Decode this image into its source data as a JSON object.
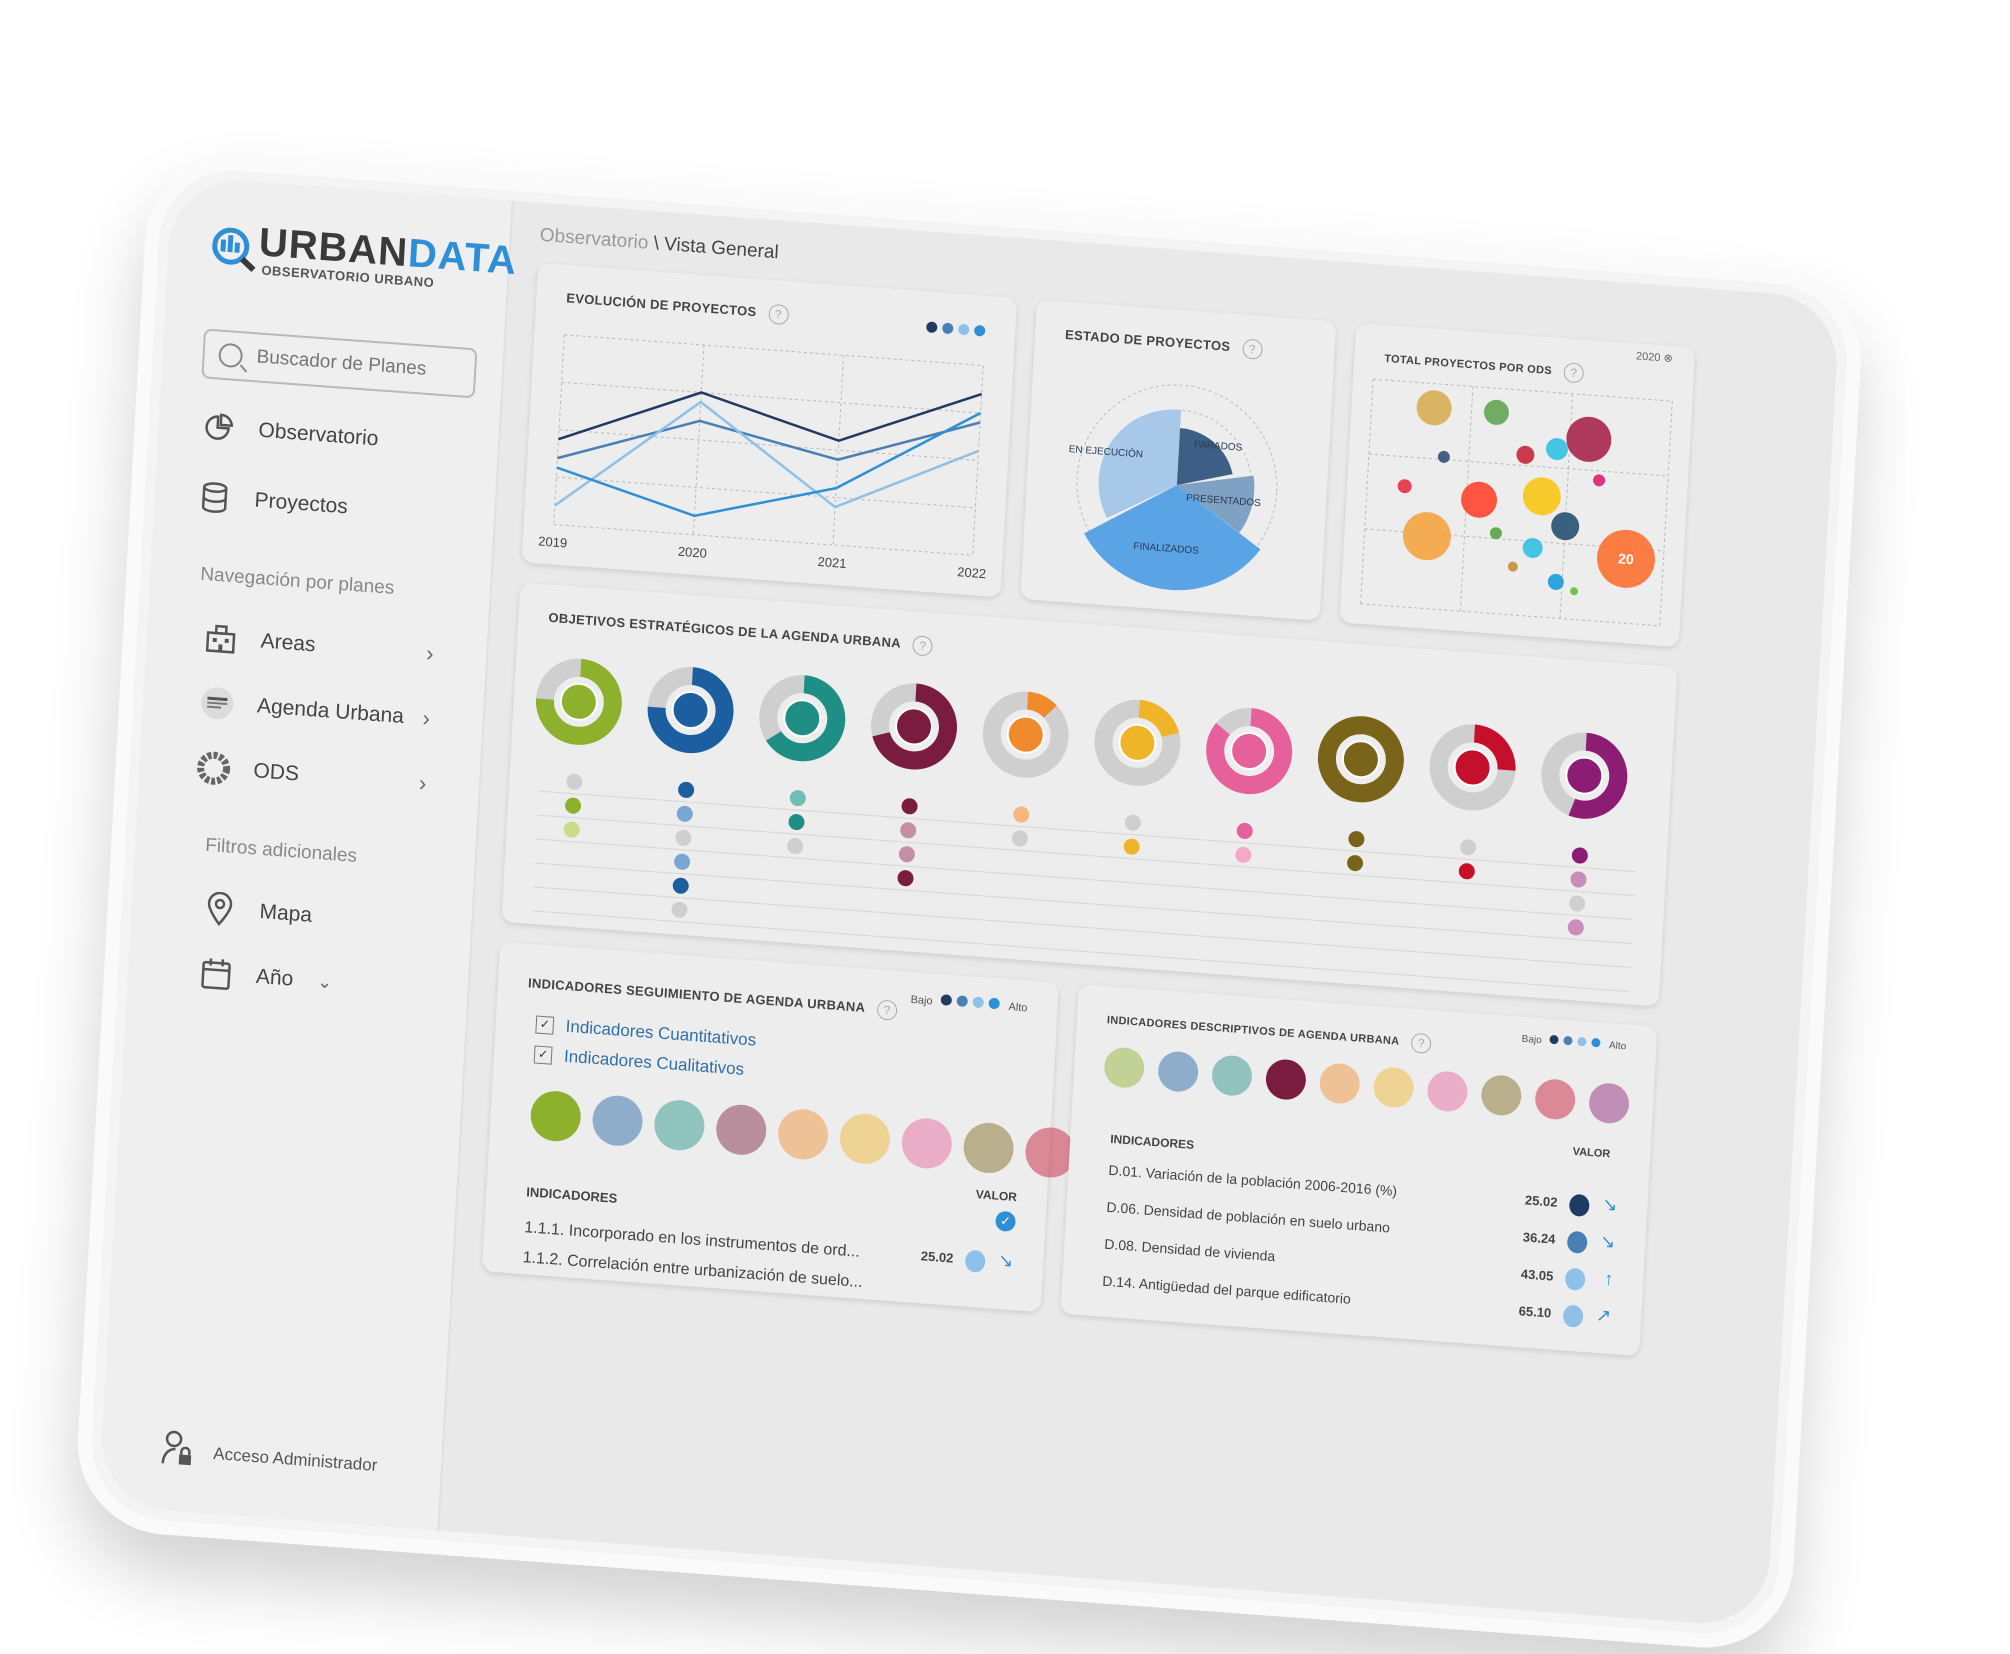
{
  "app": {
    "logo_title_part1": "URBAN",
    "logo_title_part2": "DATA",
    "logo_subtitle": "OBSERVATORIO URBANO"
  },
  "sidebar": {
    "search_placeholder": "Buscador de Planes",
    "items": [
      {
        "label": "Observatorio",
        "icon": "pie-chart-icon"
      },
      {
        "label": "Proyectos",
        "icon": "database-icon"
      }
    ],
    "nav_section": "Navegación por planes",
    "plan_items": [
      {
        "label": "Areas",
        "icon": "buildings-icon"
      },
      {
        "label": "Agenda Urbana",
        "icon": "agenda-urbana-icon"
      },
      {
        "label": "ODS",
        "icon": "ods-wheel-icon"
      }
    ],
    "filters_section": "Filtros adicionales",
    "filter_items": [
      {
        "label": "Mapa",
        "icon": "map-pin-icon"
      },
      {
        "label": "Año",
        "icon": "calendar-icon"
      }
    ],
    "admin_label": "Acceso Administrador"
  },
  "breadcrumb": {
    "parent": "Observatorio",
    "separator": "\\",
    "current": "Vista General"
  },
  "cards": {
    "evolucion": {
      "title": "EVOLUCIÓN  DE PROYECTOS",
      "help": "?",
      "legend_colors": [
        "#1f3b63",
        "#4a7fb5",
        "#8ec1ea",
        "#2f8fd6"
      ]
    },
    "estado": {
      "title": "ESTADO DE PROYECTOS",
      "help": "?",
      "labels": [
        "EN EJECUCIÓN",
        "PARADOS",
        "PRESENTADOS",
        "FINALIZADOS"
      ]
    },
    "total_ods": {
      "title": "TOTAL PROYECTOS POR ODS",
      "help": "?",
      "year_chip": "2020",
      "big_label": "20"
    },
    "objetivos": {
      "title": "OBJETIVOS ESTRATÉGICOS DE LA AGENDA URBANA",
      "help": "?",
      "goals": [
        {
          "color": "#8db12c",
          "fill": 0.75,
          "dots": [
            "#cfcfcf",
            "#8db12c",
            "#c8dd8a"
          ]
        },
        {
          "color": "#1b5fa1",
          "fill": 0.75,
          "dots": [
            "#1b5fa1",
            "#7aa6d3",
            "#cfcfcf",
            "#7aa6d3",
            "#1b5fa1",
            "#cfcfcf"
          ]
        },
        {
          "color": "#1f8f86",
          "fill": 0.65,
          "dots": [
            "#6fbdb6",
            "#1f8f86",
            "#cfcfcf"
          ]
        },
        {
          "color": "#7a1c3e",
          "fill": 0.7,
          "dots": [
            "#7a1c3e",
            "#c48fa2",
            "#c48fa2",
            "#7a1c3e"
          ]
        },
        {
          "color": "#ef8b2c",
          "fill": 0.12,
          "dots": [
            "#f4b77c",
            "#cfcfcf"
          ]
        },
        {
          "color": "#f0b429",
          "fill": 0.2,
          "dots": [
            "#cfcfcf",
            "#f0b429"
          ]
        },
        {
          "color": "#e6609c",
          "fill": 0.85,
          "dots": [
            "#e6609c",
            "#f2a9c8"
          ]
        },
        {
          "color": "#7a6419",
          "fill": 1.0,
          "dots": [
            "#7a6419",
            "#7a6419"
          ]
        },
        {
          "color": "#c5102c",
          "fill": 0.25,
          "dots": [
            "#cfcfcf",
            "#c5102c"
          ]
        },
        {
          "color": "#8c1c74",
          "fill": 0.55,
          "dots": [
            "#8c1c74",
            "#c98dbb",
            "#cfcfcf",
            "#c98dbb"
          ]
        }
      ]
    },
    "seguimiento": {
      "title": "INDICADORES SEGUIMIENTO DE AGENDA URBANA",
      "help": "?",
      "legend_low": "Bajo",
      "legend_high": "Alto",
      "legend_colors": [
        "#1f3b63",
        "#4a7fb5",
        "#8ec1ea",
        "#2f8fd6"
      ],
      "checkboxes": [
        "Indicadores Cuantitativos",
        "Indicadores Cualitativos"
      ],
      "col_valor": "VALOR",
      "col_indicadores": "INDICADORES",
      "rows": [
        {
          "label": "1.1.1. Incorporado en los instrumentos de ord...",
          "value": "25.02"
        },
        {
          "label": "1.1.2. Correlación entre urbanización de suelo...",
          "value": ""
        }
      ]
    },
    "descriptivos": {
      "title": "INDICADORES DESCRIPTIVOS DE AGENDA URBANA",
      "help": "?",
      "legend_low": "Bajo",
      "legend_high": "Alto",
      "legend_colors": [
        "#1f3b63",
        "#4a7fb5",
        "#8ec1ea",
        "#2f8fd6"
      ],
      "col_valor": "VALOR",
      "col_indicadores": "INDICADORES",
      "rows": [
        {
          "label": "D.01. Variación de la población 2006-2016 (%)",
          "value": "25.02",
          "arrow": "↘"
        },
        {
          "label": "D.06. Densidad de población en suelo urbano",
          "value": "36.24",
          "arrow": "↘"
        },
        {
          "label": "D.08. Densidad de vivienda",
          "value": "43.05",
          "arrow": "↑"
        },
        {
          "label": "D.14. Antigüedad del parque edificatorio",
          "value": "65.10",
          "arrow": "↗"
        }
      ]
    }
  },
  "chart_data": [
    {
      "type": "line",
      "x": [
        "2019",
        "2020",
        "2021",
        "2022"
      ],
      "series": [
        {
          "values": [
            45,
            75,
            55,
            85
          ]
        },
        {
          "values": [
            35,
            60,
            45,
            70
          ]
        },
        {
          "values": [
            10,
            70,
            20,
            55
          ]
        },
        {
          "values": [
            30,
            10,
            30,
            75
          ]
        }
      ]
    },
    {
      "type": "pie",
      "categories": [
        "EN EJECUCIÓN",
        "PARADOS",
        "PRESENTADOS",
        "FINALIZADOS"
      ]
    },
    {
      "type": "scatter",
      "points": [
        {
          "x": 1,
          "y": 5,
          "size": 35,
          "color": "#d6a84a"
        },
        {
          "x": 2,
          "y": 5,
          "size": 25,
          "color": "#5aa04a"
        },
        {
          "x": 3.5,
          "y": 4.5,
          "size": 45,
          "color": "#a21942"
        },
        {
          "x": 1.2,
          "y": 3.8,
          "size": 12,
          "color": "#26486b"
        },
        {
          "x": 2.5,
          "y": 4,
          "size": 18,
          "color": "#c5192d"
        },
        {
          "x": 3,
          "y": 4.2,
          "size": 22,
          "color": "#26bde2"
        },
        {
          "x": 0.6,
          "y": 3,
          "size": 14,
          "color": "#e5243b"
        },
        {
          "x": 1.8,
          "y": 2.8,
          "size": 36,
          "color": "#ff3a21"
        },
        {
          "x": 2.8,
          "y": 3,
          "size": 38,
          "color": "#fcc30b"
        },
        {
          "x": 3.7,
          "y": 3.5,
          "size": 12,
          "color": "#dd1367"
        },
        {
          "x": 1,
          "y": 1.8,
          "size": 48,
          "color": "#f5a036"
        },
        {
          "x": 2.1,
          "y": 2,
          "size": 12,
          "color": "#4c9f38"
        },
        {
          "x": 3.2,
          "y": 2.3,
          "size": 28,
          "color": "#19486a"
        },
        {
          "x": 2.7,
          "y": 1.7,
          "size": 20,
          "color": "#26bde2"
        },
        {
          "x": 2.4,
          "y": 1.2,
          "size": 10,
          "color": "#bf8b2e"
        },
        {
          "x": 3.1,
          "y": 0.9,
          "size": 16,
          "color": "#0a97d9"
        },
        {
          "x": 3.4,
          "y": 0.7,
          "size": 8,
          "color": "#56c02b"
        },
        {
          "x": 4.2,
          "y": 1.6,
          "size": 58,
          "color": "#fd6925",
          "label": "20"
        }
      ]
    }
  ]
}
